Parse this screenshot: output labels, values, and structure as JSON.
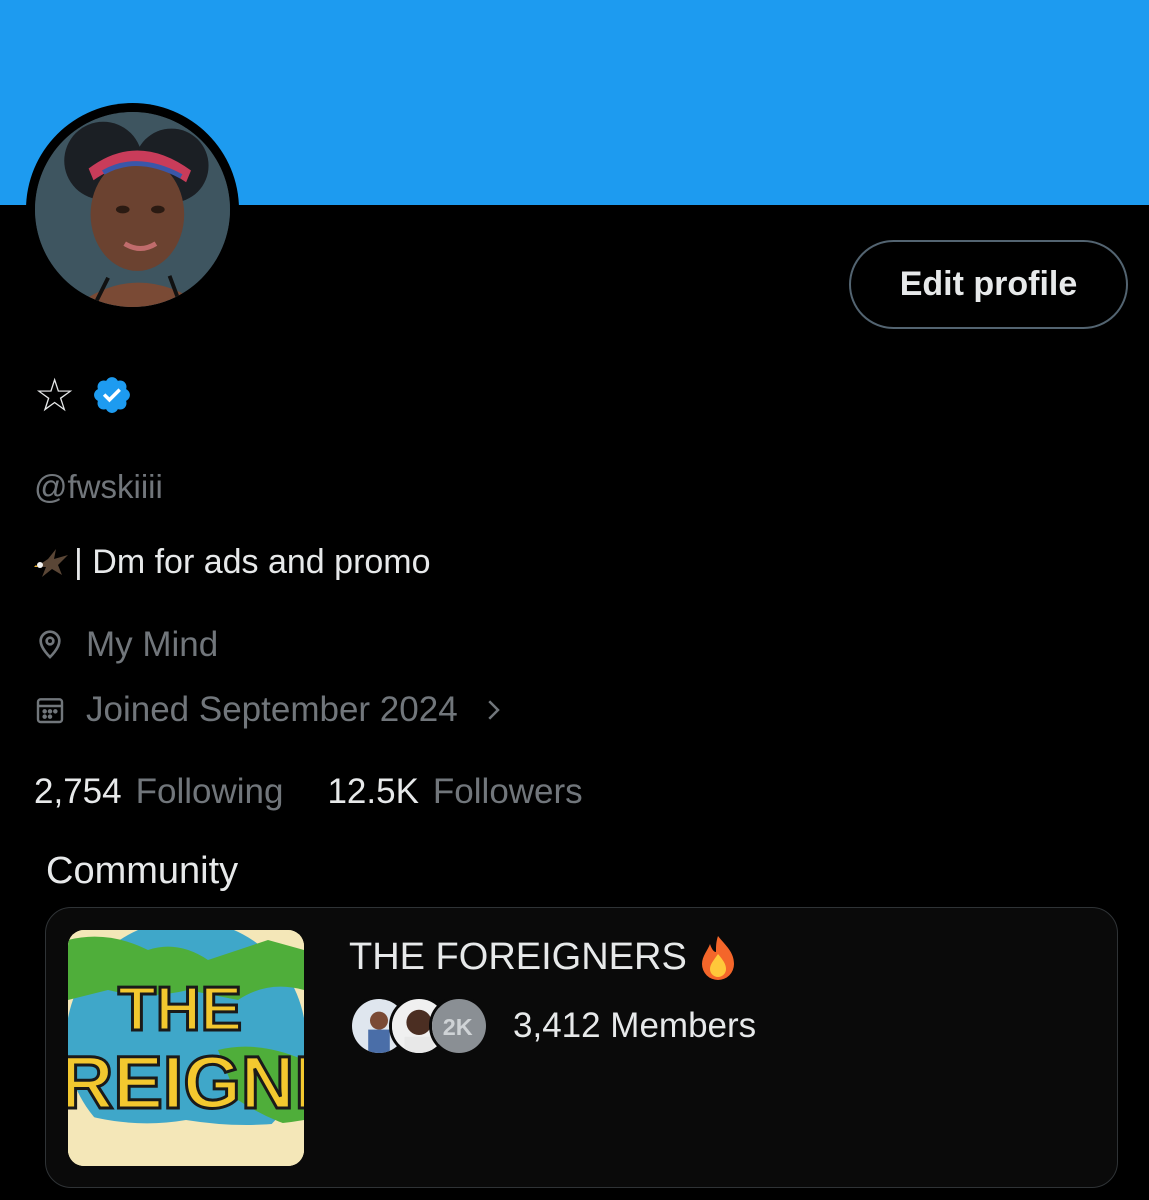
{
  "profile": {
    "display_name": "☆",
    "handle": "@fwskiiii",
    "bio": "| Dm for ads and promo",
    "location": "My Mind",
    "joined": "Joined September 2024",
    "edit_button_label": "Edit profile",
    "verified": true
  },
  "stats": {
    "following_count": "2,754",
    "following_label": "Following",
    "followers_count": "12.5K",
    "followers_label": "Followers"
  },
  "community": {
    "section_title": "Community",
    "name": "THE FOREIGNERS",
    "members": "3,412 Members",
    "image_text": "THE REIGNI"
  },
  "colors": {
    "banner": "#1d9bf0",
    "background": "#000000",
    "verified_badge": "#1d9bf0",
    "muted_text": "#71767b"
  },
  "icons": [
    "verified-badge-icon",
    "eagle-emoji-icon",
    "location-pin-icon",
    "calendar-icon",
    "chevron-right-icon",
    "fire-emoji-icon"
  ]
}
